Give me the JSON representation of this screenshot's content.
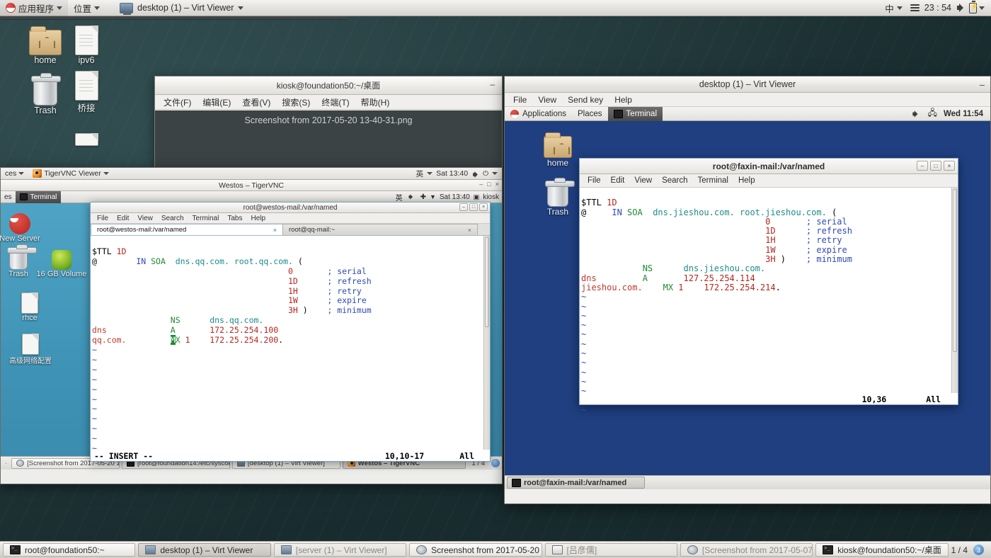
{
  "top_panel": {
    "applications_label": "应用程序",
    "places_label": "位置",
    "window_label": "desktop (1) – Virt Viewer",
    "input_method": "中",
    "clock": "23 : 54",
    "icons": [
      "redhat-icon",
      "caret-down-icon",
      "hamburger-icon",
      "volume-icon",
      "battery-icon"
    ]
  },
  "desktop_icons": [
    {
      "label": "home",
      "icon": "folder-icon"
    },
    {
      "label": "ipv6",
      "icon": "document-icon"
    },
    {
      "label": "Trash",
      "icon": "trash-icon"
    },
    {
      "label": "桥接",
      "icon": "document-icon"
    }
  ],
  "screenshot_window": {
    "title": "Screenshot from 2017-05-20 13-40-31.png",
    "minimize": "–"
  },
  "kiosk_window": {
    "title": "kiosk@foundation50:~/桌面",
    "minimize": "–",
    "menu": [
      "文件(F)",
      "编辑(E)",
      "查看(V)",
      "搜索(S)",
      "终端(T)",
      "帮助(H)"
    ]
  },
  "vnc_window": {
    "host_panel": {
      "places_label": "ces",
      "viewer_label": "TigerVNC Viewer",
      "input_method": "英",
      "clock": "Sat 13:40"
    },
    "title": "Westos – TigerVNC",
    "buttons": [
      "–",
      "□",
      "×"
    ],
    "inner_panel": {
      "places_label": "es",
      "terminal_label": "Terminal",
      "input_method": "英",
      "clock": "Sat 13:40",
      "user": "kiosk"
    },
    "desktop_icons": [
      {
        "label": "New Server",
        "icon": "redhat-icon"
      },
      {
        "label": "Trash",
        "icon": "trash-icon"
      },
      {
        "label": "16 GB Volume",
        "icon": "volume-icon"
      },
      {
        "label": "rhce",
        "icon": "document-icon"
      },
      {
        "label": "高级网络配置",
        "icon": "document-icon"
      }
    ],
    "taskbar": {
      "items": [
        {
          "label": "[Screenshot from 2017-05-20 1…",
          "icon": "screenshot-icon",
          "active": false
        },
        {
          "label": "[root@foundation14:/etc/syscon…",
          "icon": "terminal-icon",
          "active": false
        },
        {
          "label": "[desktop (1) – Virt Viewer]",
          "icon": "screen-icon",
          "active": false
        },
        {
          "label": "Westos – TigerVNC",
          "icon": "tigervnc-icon",
          "active": true
        }
      ],
      "pager": "1 / 4"
    }
  },
  "westos_terminal": {
    "title": "root@westos-mail:/var/named",
    "buttons": [
      "–",
      "□",
      "×"
    ],
    "menu": [
      "File",
      "Edit",
      "View",
      "Search",
      "Terminal",
      "Tabs",
      "Help"
    ],
    "tabs": [
      {
        "label": "root@westos-mail:/var/named",
        "close": "×",
        "active": true
      },
      {
        "label": "root@qq-mail:~",
        "close": "×",
        "active": false
      }
    ],
    "content_lines": [
      "$TTL 1D",
      "@        IN SOA  dns.qq.com. root.qq.com. (",
      "                                        0       ; serial",
      "                                        1D      ; refresh",
      "                                        1H      ; retry",
      "                                        1W      ; expire",
      "                                        3H )    ; minimum",
      "                NS      dns.qq.com.",
      "dns             A       172.25.254.100",
      "qq.com.         MX 1    172.25.254.200."
    ],
    "status": {
      "mode": "-- INSERT --",
      "position": "10,10-17",
      "scroll": "All"
    }
  },
  "virt_viewer": {
    "title": "desktop (1) – Virt Viewer",
    "minimize": "–",
    "menu": [
      "File",
      "View",
      "Send key",
      "Help"
    ],
    "guest_panel": {
      "applications_label": "Applications",
      "places_label": "Places",
      "terminal_label": "Terminal",
      "clock": "Wed 11:54",
      "icons": [
        "redhat-icon",
        "volume-icon",
        "network-icon"
      ]
    },
    "guest_desktop_icons": [
      {
        "label": "home",
        "icon": "folder-icon"
      },
      {
        "label": "Trash",
        "icon": "trash-icon"
      }
    ],
    "guest_taskbar": {
      "items": [
        {
          "label": "root@faxin-mail:/var/named",
          "icon": "terminal-icon",
          "active": true
        }
      ]
    }
  },
  "faxin_terminal": {
    "title": "root@faxin-mail:/var/named",
    "buttons": [
      "–",
      "□",
      "×"
    ],
    "menu": [
      "File",
      "Edit",
      "View",
      "Search",
      "Terminal",
      "Help"
    ],
    "content_lines": [
      "$TTL 1D",
      "@     IN SOA  dns.jieshou.com. root.jieshou.com. (",
      "                                    0       ; serial",
      "                                    1D      ; refresh",
      "                                    1H      ; retry",
      "                                    1W      ; expire",
      "                                    3H )    ; minimum",
      "            NS      dns.jieshou.com.",
      "dns         A       127.25.254.114",
      "jieshou.com.    MX 1    172.25.254.214."
    ],
    "status": {
      "position": "10,36",
      "scroll": "All"
    }
  },
  "bottom_taskbar": {
    "items": [
      {
        "label": "root@foundation50:~",
        "icon": "terminal-icon",
        "state": "normal"
      },
      {
        "label": "desktop (1) – Virt Viewer",
        "icon": "screen-icon",
        "state": "active"
      },
      {
        "label": "[server (1) – Virt Viewer]",
        "icon": "screen-icon",
        "state": "minimized"
      },
      {
        "label": "Screenshot from 2017-05-20 1…",
        "icon": "screenshot-icon",
        "state": "normal"
      },
      {
        "label": "[吕彦儒]",
        "icon": "document-icon",
        "state": "minimized"
      },
      {
        "label": "[Screenshot from 2017-05-07 …",
        "icon": "screenshot-icon",
        "state": "minimized"
      },
      {
        "label": "kiosk@foundation50:~/桌面",
        "icon": "terminal-icon",
        "state": "normal"
      }
    ],
    "pager": "1 / 4",
    "pager_badge": "3"
  },
  "colors": {
    "desktop_bg": "#1d3437",
    "vnc_desk_bg": "#3f93b6",
    "guest_desk_bg": "#1f3f80",
    "term_red": "#b3261e",
    "term_green": "#1f8a32",
    "term_blue": "#2f49b5",
    "term_teal": "#1f8a8a"
  }
}
